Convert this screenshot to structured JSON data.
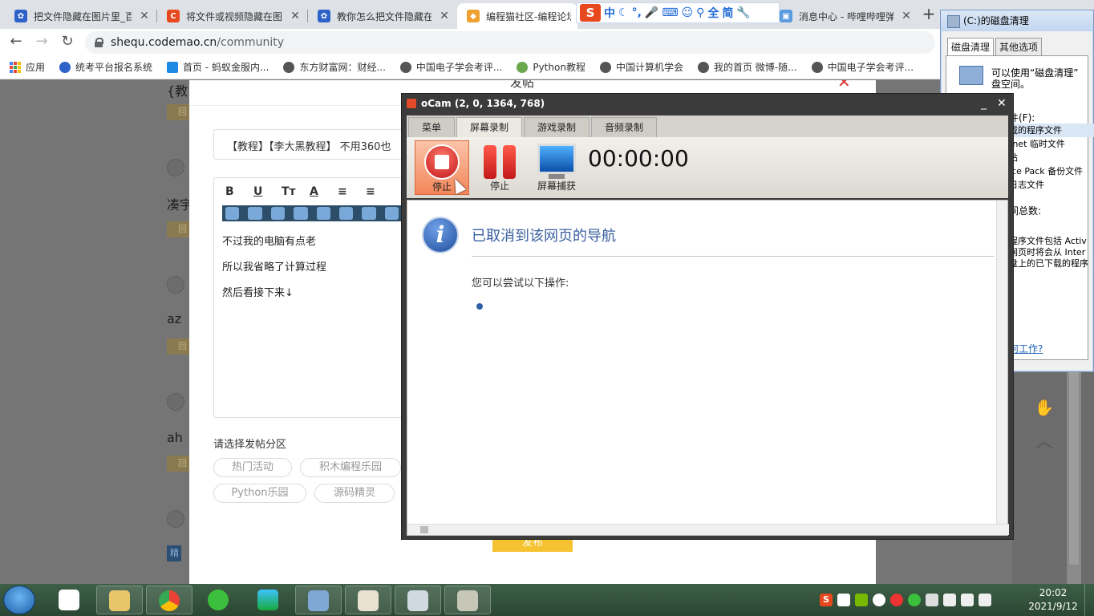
{
  "browser": {
    "tabs": [
      {
        "title": "把文件隐藏在图片里_百",
        "icon": "paw-icon"
      },
      {
        "title": "将文件或视频隐藏在图",
        "icon": "c-icon"
      },
      {
        "title": "教你怎么把文件隐藏在",
        "icon": "paw-icon"
      },
      {
        "title": "编程猫社区-编程论坛",
        "icon": "codemao-icon"
      },
      {
        "title": "消息中心 - 哔哩哔哩弹",
        "icon": "bilibili-icon"
      }
    ],
    "url_host": "shequ.codemao.cn",
    "url_path": "/community",
    "bookmarks": [
      "应用",
      "统考平台报名系统",
      "首页 - 蚂蚁金服内...",
      "东方财富网：财经...",
      "中国电子学会考评...",
      "Python教程",
      "中国计算机学会",
      "我的首页 微博-随...",
      "中国电子学会考评..."
    ],
    "ime": {
      "logo": "S",
      "labels": [
        "中",
        "全",
        "简"
      ]
    }
  },
  "page": {
    "modal_title": "发帖",
    "title_value": "【教程】【李大黑教程】 不用360也",
    "toolbar": [
      "B",
      "U",
      "Tт",
      "A",
      "≡",
      "≡"
    ],
    "body_lines": [
      "不过我的电脑有点老",
      "所以我省略了计算过程",
      "然后看接下来↓"
    ],
    "section_label": "请选择发帖分区",
    "sections": [
      "热门活动",
      "积木编程乐园",
      "Python乐园",
      "源码精灵"
    ],
    "publish": "发布",
    "side_items": [
      "{教",
      "凑宇",
      "az",
      "ah"
    ],
    "reply": "回",
    "elite": "精"
  },
  "disk_cleanup": {
    "title": "(C:)的磁盘清理",
    "tabs": [
      "磁盘清理",
      "其他选项"
    ],
    "desc": [
      "可以使用“磁盘清理”",
      "盘空间。"
    ],
    "files_label": "件(F):",
    "list": [
      "载的程序文件",
      "rnet 临时文件",
      "站",
      "ice Pack 备份文件",
      "日志文件"
    ],
    "total": "间总数:",
    "note": [
      "程序文件包括 Activ",
      "网页时将会从 Inter",
      "盘上的已下载的程序"
    ],
    "link": "何工作?"
  },
  "ocam": {
    "title": "oCam (2, 0, 1364, 768)",
    "tabs": [
      "菜单",
      "屏幕录制",
      "游戏录制",
      "音频录制"
    ],
    "buttons": [
      "停止",
      "停止",
      "屏幕捕获"
    ],
    "timer": "00:00:00",
    "nav_heading": "已取消到该网页的导航",
    "nav_sub": "您可以尝试以下操作:"
  },
  "taskbar": {
    "time": "20:02",
    "date": "2021/9/12",
    "ime_logo": "S"
  }
}
